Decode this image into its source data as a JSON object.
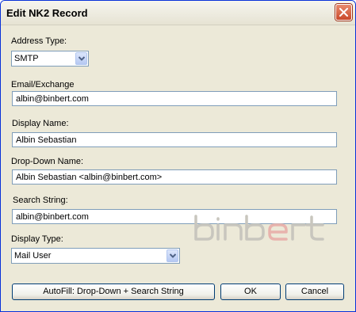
{
  "window": {
    "title": "Edit NK2 Record"
  },
  "address_type": {
    "label": "Address Type:",
    "value": "SMTP"
  },
  "email": {
    "label": "Email/Exchange",
    "value": "albin@binbert.com"
  },
  "display_name": {
    "label": "Display Name:",
    "value": "Albin Sebastian"
  },
  "dropdown_name": {
    "label": "Drop-Down Name:",
    "value": "Albin Sebastian  <albin@binbert.com>"
  },
  "search_string": {
    "label": "Search String:",
    "value": "albin@binbert.com"
  },
  "display_type": {
    "label": "Display Type:",
    "value": "Mail User"
  },
  "buttons": {
    "autofill": "AutoFill:  Drop-Down + Search String",
    "ok": "OK",
    "cancel": "Cancel"
  },
  "watermark": {
    "text": "binbert",
    "colors": {
      "main": "#c8c6be",
      "accent": "#e8b3ad"
    }
  },
  "colors": {
    "titlebar_border": "#0831d9",
    "face": "#ece9d8",
    "field_border": "#7f9db9"
  }
}
